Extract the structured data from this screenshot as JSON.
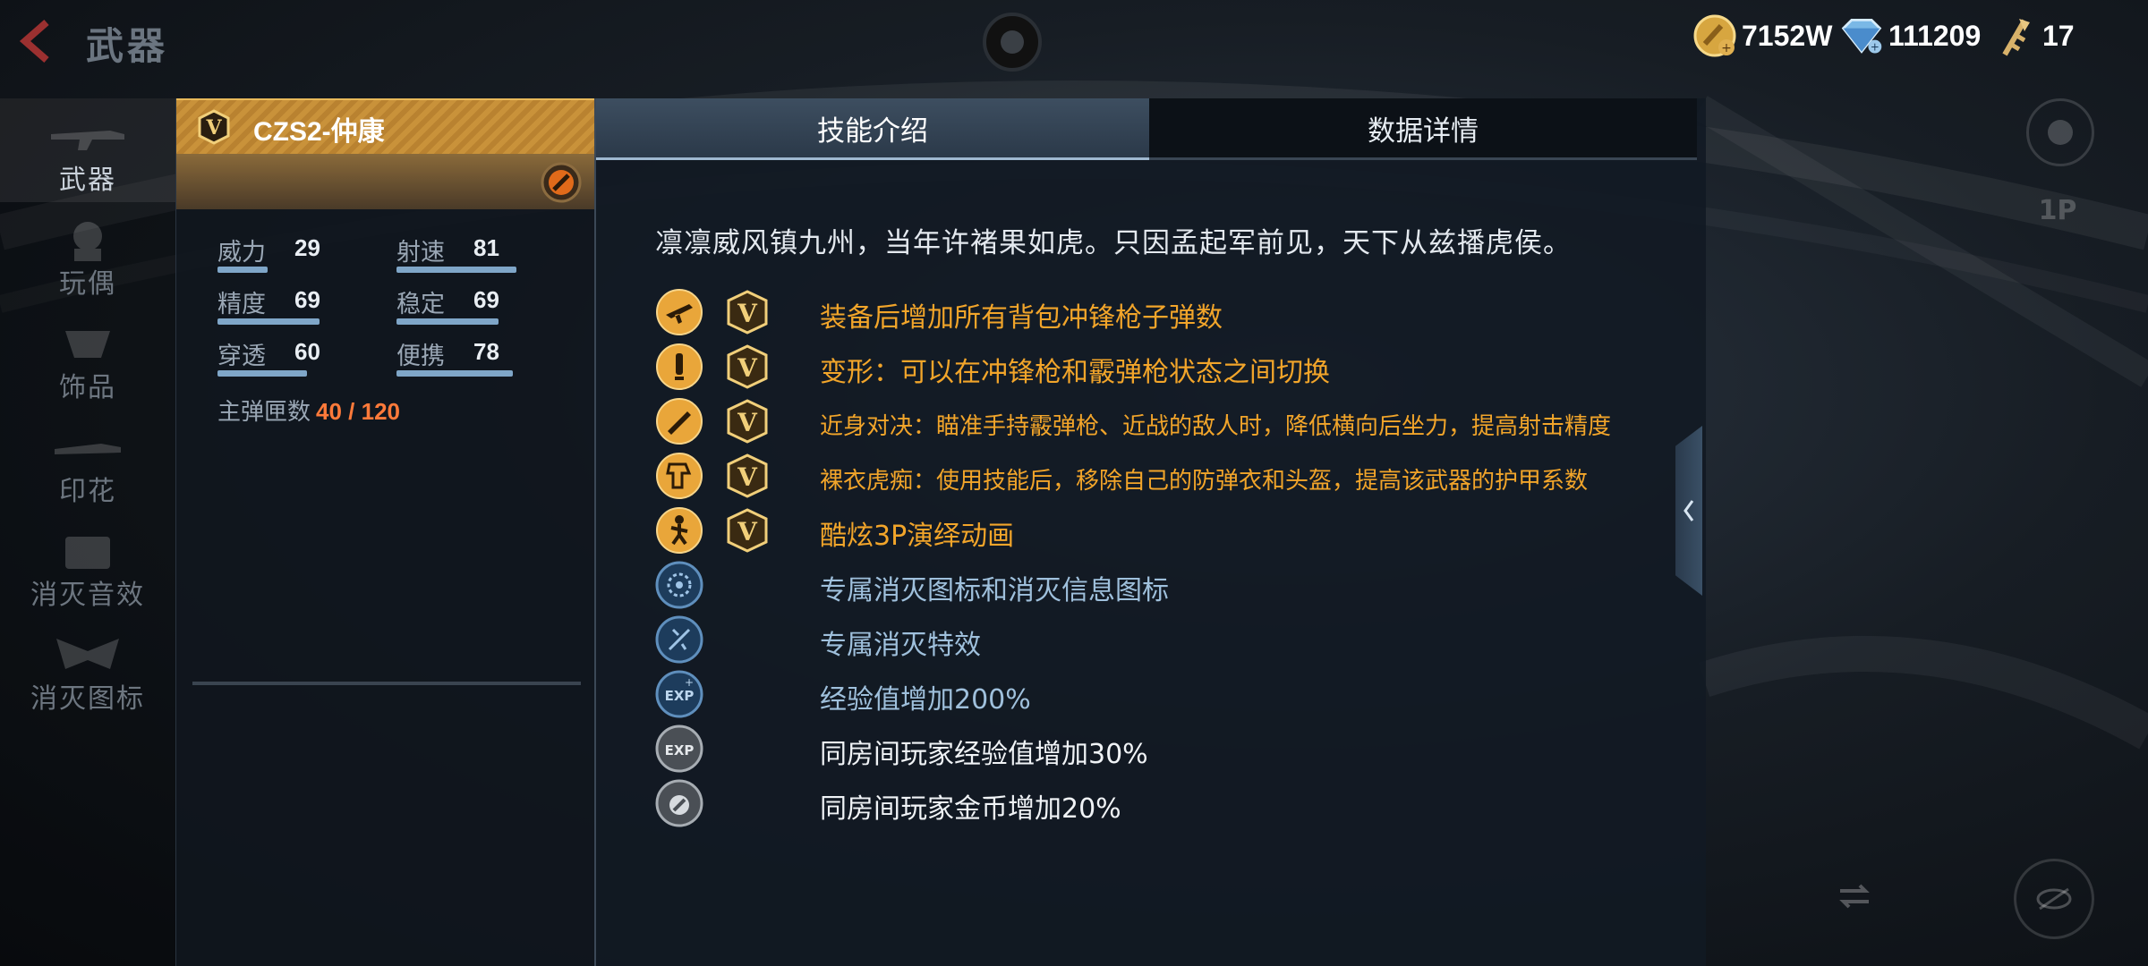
{
  "topbar": {
    "title": "武器",
    "currencies": [
      {
        "icon": "gold-coin-icon",
        "value": "7152W"
      },
      {
        "icon": "diamond-icon",
        "value": "111209"
      },
      {
        "icon": "key-icon",
        "value": "17"
      }
    ]
  },
  "sidenav": {
    "items": [
      {
        "label": "武器",
        "active": true
      },
      {
        "label": "玩偶"
      },
      {
        "label": "饰品"
      },
      {
        "label": "印花"
      },
      {
        "label": "消灭音效"
      },
      {
        "label": "消灭图标"
      }
    ]
  },
  "weapon": {
    "name": "CZS2-仲康",
    "stats": [
      {
        "label": "威力",
        "value": "29"
      },
      {
        "label": "射速",
        "value": "81"
      },
      {
        "label": "精度",
        "value": "69"
      },
      {
        "label": "稳定",
        "value": "69"
      },
      {
        "label": "穿透",
        "value": "60"
      },
      {
        "label": "便携",
        "value": "78"
      }
    ],
    "ammo_label": "主弹匣数",
    "ammo_value": "40 / 120"
  },
  "tabs": {
    "skills": "技能介绍",
    "details": "数据详情"
  },
  "description": "凛凛威风镇九州，当年许褚果如虎。只因孟起军前见，天下从兹播虎侯。",
  "skills": [
    {
      "icon": "rifle-icon",
      "vip": true,
      "text": "装备后增加所有背包冲锋枪子弹数",
      "color": "gold"
    },
    {
      "icon": "ammo-icon",
      "vip": true,
      "text": "变形：可以在冲锋枪和霰弹枪状态之间切换",
      "color": "gold"
    },
    {
      "icon": "knife-icon",
      "vip": true,
      "text": "近身对决：瞄准手持霰弹枪、近战的敌人时，降低横向后坐力，提高射击精度",
      "color": "gold"
    },
    {
      "icon": "armor-icon",
      "vip": true,
      "text": "裸衣虎痴：使用技能后，移除自己的防弹衣和头盔，提高该武器的护甲系数",
      "color": "gold"
    },
    {
      "icon": "dance-icon",
      "vip": true,
      "text": "酷炫3P演绎动画",
      "color": "gold"
    },
    {
      "icon": "kill-icon-badge",
      "vip": false,
      "text": "专属消灭图标和消灭信息图标",
      "color": "blue"
    },
    {
      "icon": "kill-effect-icon",
      "vip": false,
      "text": "专属消灭特效",
      "color": "blue"
    },
    {
      "icon": "exp-icon",
      "vip": false,
      "text": "经验值增加200%",
      "color": "blue"
    },
    {
      "icon": "room-exp-icon",
      "vip": false,
      "text": "同房间玩家经验值增加30%",
      "color": "white"
    },
    {
      "icon": "room-coin-icon",
      "vip": false,
      "text": "同房间玩家金币增加20%",
      "color": "white"
    }
  ],
  "right_hud": {
    "view_toggle": "1P"
  }
}
